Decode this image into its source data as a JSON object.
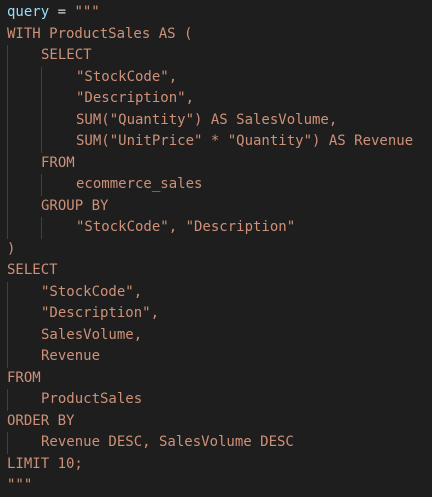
{
  "code": {
    "var_name": "query",
    "assign_op": " = ",
    "open_quotes": "\"\"\"",
    "lines": [
      "WITH ProductSales AS (",
      "SELECT",
      "\"StockCode\",",
      "\"Description\",",
      "SUM(\"Quantity\") AS SalesVolume,",
      "SUM(\"UnitPrice\" * \"Quantity\") AS Revenue",
      "FROM",
      "ecommerce_sales",
      "GROUP BY",
      "\"StockCode\", \"Description\"",
      ")",
      "SELECT",
      "\"StockCode\",",
      "\"Description\",",
      "SalesVolume,",
      "Revenue",
      "FROM",
      "ProductSales",
      "ORDER BY",
      "Revenue DESC, SalesVolume DESC",
      "LIMIT 10;",
      "\"\"\""
    ]
  },
  "colors": {
    "background": "#1e1e1e",
    "variable": "#9cdcfe",
    "operator": "#d4d4d4",
    "string": "#ce9178",
    "indent_guide": "#404040"
  }
}
